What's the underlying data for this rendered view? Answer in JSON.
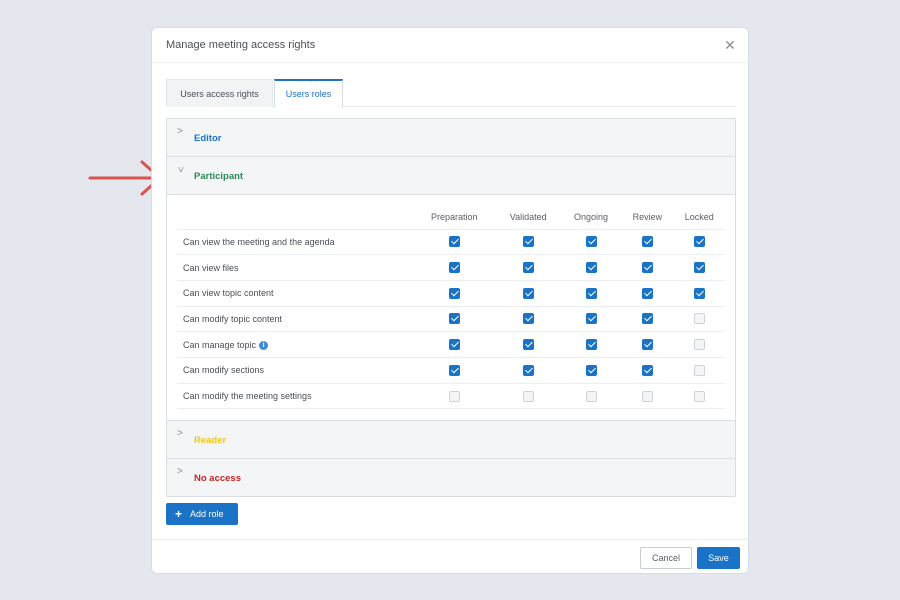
{
  "dialog": {
    "title": "Manage meeting access rights"
  },
  "tabs": [
    {
      "label": "Users access rights",
      "active": false
    },
    {
      "label": "Users roles",
      "active": true
    }
  ],
  "roles": [
    {
      "name": "Editor",
      "color": "#1a73c6",
      "expanded": false
    },
    {
      "name": "Participant",
      "color": "#2e8b57",
      "expanded": true
    },
    {
      "name": "Reader",
      "color": "#f0c419",
      "expanded": false
    },
    {
      "name": "No access",
      "color": "#c62828",
      "expanded": false
    }
  ],
  "permissions": {
    "columns": [
      "Preparation",
      "Validated",
      "Ongoing",
      "Review",
      "Locked"
    ],
    "rows": [
      {
        "label": "Can view the meeting and the agenda",
        "info": false,
        "values": [
          true,
          true,
          true,
          true,
          true
        ]
      },
      {
        "label": "Can view files",
        "info": false,
        "values": [
          true,
          true,
          true,
          true,
          true
        ]
      },
      {
        "label": "Can view topic content",
        "info": false,
        "values": [
          true,
          true,
          true,
          true,
          true
        ]
      },
      {
        "label": "Can modify topic content",
        "info": false,
        "values": [
          true,
          true,
          true,
          true,
          false
        ]
      },
      {
        "label": "Can manage topic",
        "info": true,
        "values": [
          true,
          true,
          true,
          true,
          false
        ]
      },
      {
        "label": "Can modify sections",
        "info": false,
        "values": [
          true,
          true,
          true,
          true,
          false
        ]
      },
      {
        "label": "Can modify the meeting settings",
        "info": false,
        "values": [
          false,
          false,
          false,
          false,
          false
        ]
      }
    ]
  },
  "buttons": {
    "add_role": "Add role",
    "cancel": "Cancel",
    "save": "Save"
  },
  "colors": {
    "accent": "#1a73c6",
    "arrow": "#d9534f"
  },
  "icons": {
    "close": "close-icon",
    "collapsed": "chevron-right-icon",
    "expanded": "chevron-down-icon",
    "info": "info-icon",
    "plus": "plus-icon"
  }
}
